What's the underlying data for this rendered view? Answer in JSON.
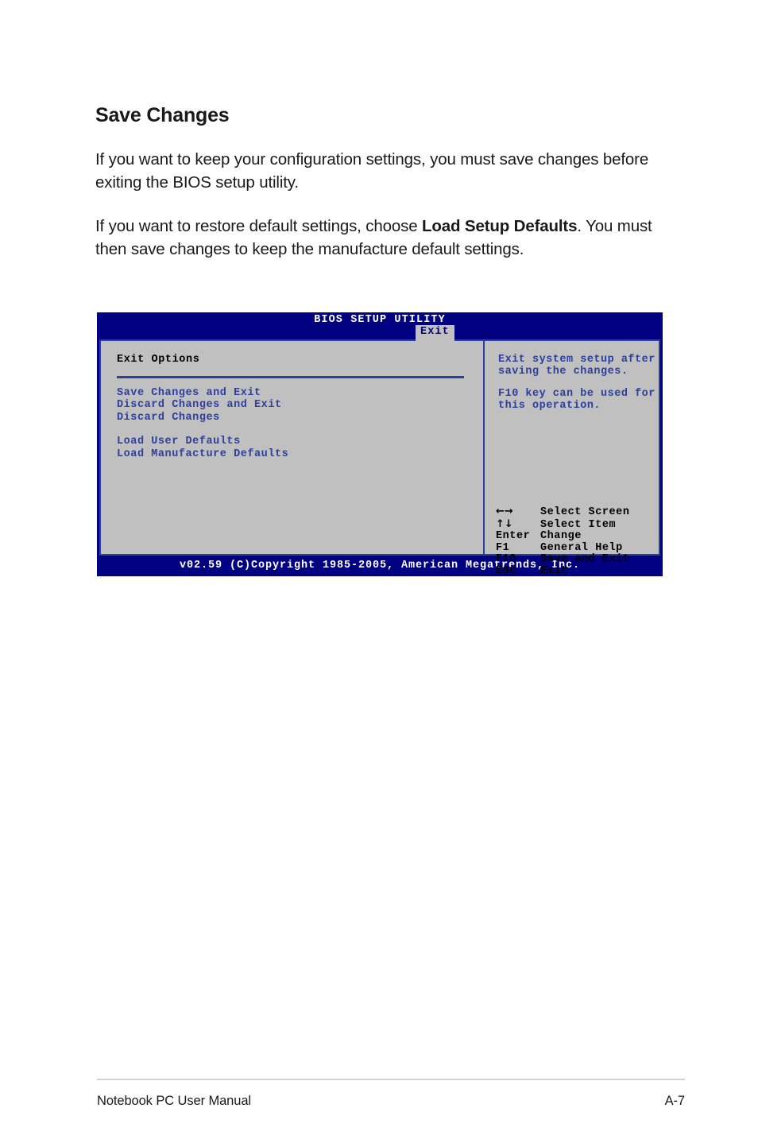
{
  "section": {
    "title": "Save Changes",
    "paragraphs": [
      {
        "before": "If you want to keep your configuration settings, you must save changes before exiting the BIOS setup utility.",
        "bold": "",
        "after": ""
      },
      {
        "before": "If you want to restore default settings, choose ",
        "bold": "Load Setup Defaults",
        "after": ". You must then save changes to keep the manufacture default settings."
      }
    ]
  },
  "bios": {
    "title": "BIOS SETUP UTILITY",
    "active_tab": "Exit",
    "left_panel": {
      "heading": "Exit Options",
      "menu_group_1": [
        "Save Changes and Exit",
        "Discard Changes and Exit",
        "Discard Changes"
      ],
      "menu_group_2": [
        "Load User Defaults",
        "Load Manufacture Defaults"
      ]
    },
    "right_panel": {
      "help_block_1": [
        "Exit system setup after",
        "saving the changes."
      ],
      "help_block_2": [
        "F10 key can be used for",
        "this operation."
      ],
      "legend": [
        {
          "key": "←→",
          "key_icon": "left-right-arrows",
          "desc": "Select Screen"
        },
        {
          "key": "↑↓",
          "key_icon": "up-down-arrows",
          "desc": "Select Item"
        },
        {
          "key": "Enter",
          "key_icon": "",
          "desc": "Change"
        },
        {
          "key": "F1",
          "key_icon": "",
          "desc": "General Help"
        },
        {
          "key": "F10",
          "key_icon": "",
          "desc": "Save and Exit"
        },
        {
          "key": "ESC",
          "key_icon": "",
          "desc": "Exit"
        }
      ]
    },
    "footer": "v02.59 (C)Copyright 1985-2005, American Megatrends, Inc."
  },
  "page_footer": {
    "manual_title": "Notebook PC User Manual",
    "page_number": "A-7"
  },
  "colors": {
    "bios_header_blue": "#000080",
    "bios_body_gray": "#c0c0c0",
    "bios_text_blue": "#2b3f9e",
    "bios_text_white": "#ffffff",
    "bios_text_black": "#000000",
    "tab_background": "#c0c0c0",
    "footer_rule": "#d4d4d4"
  }
}
